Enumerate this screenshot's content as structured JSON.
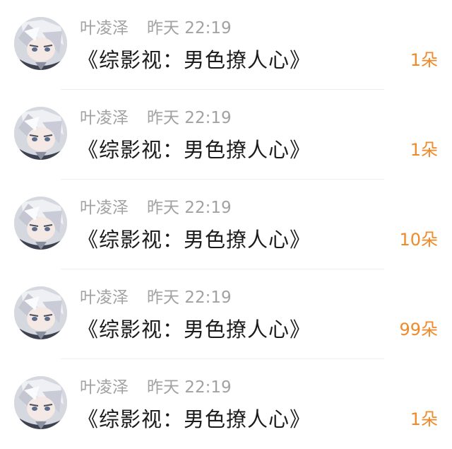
{
  "colors": {
    "accent": "#f08a28",
    "meta_text": "#a2a2a2",
    "title_text": "#1b1b1b"
  },
  "items": [
    {
      "user": "叶凌泽",
      "time": "昨天 22:19",
      "title": "《综影视：男色撩人心》",
      "count": "1朵",
      "avatar": "anime-avatar-silver-hair"
    },
    {
      "user": "叶凌泽",
      "time": "昨天 22:19",
      "title": "《综影视：男色撩人心》",
      "count": "1朵",
      "avatar": "anime-avatar-silver-hair"
    },
    {
      "user": "叶凌泽",
      "time": "昨天 22:19",
      "title": "《综影视：男色撩人心》",
      "count": "10朵",
      "avatar": "anime-avatar-silver-hair"
    },
    {
      "user": "叶凌泽",
      "time": "昨天 22:19",
      "title": "《综影视：男色撩人心》",
      "count": "99朵",
      "avatar": "anime-avatar-silver-hair"
    },
    {
      "user": "叶凌泽",
      "time": "昨天 22:19",
      "title": "《综影视：男色撩人心》",
      "count": "1朵",
      "avatar": "anime-avatar-silver-hair"
    }
  ]
}
